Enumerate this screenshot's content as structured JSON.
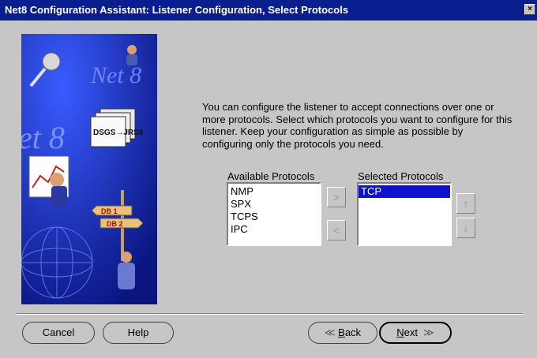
{
  "window": {
    "title": "Net8 Configuration Assistant: Listener Configuration, Select Protocols",
    "close_icon": "×"
  },
  "banner": {
    "text_net8": "Net 8",
    "text_et8": "et 8",
    "folder_text": "DSGS→JRS8",
    "db1": "DB 1",
    "db2": "DB 2"
  },
  "intro": "You can configure the listener to accept connections over one or more protocols. Select which protocols you want to configure for this listener. Keep your configuration as simple as possible by configuring only the protocols you need.",
  "available": {
    "label": "Available Protocols",
    "items": [
      "NMP",
      "SPX",
      "TCPS",
      "IPC"
    ]
  },
  "selected": {
    "label": "Selected Protocols",
    "items": [
      "TCP"
    ]
  },
  "buttons": {
    "cancel": "Cancel",
    "help": "Help",
    "back_prefix": "",
    "back_key": "B",
    "back_rest": "ack",
    "next_key": "N",
    "next_rest": "ext"
  },
  "colors": {
    "titlebar": "#0a1f8f",
    "selection": "#1010d0",
    "panel": "#c6c6c6"
  }
}
